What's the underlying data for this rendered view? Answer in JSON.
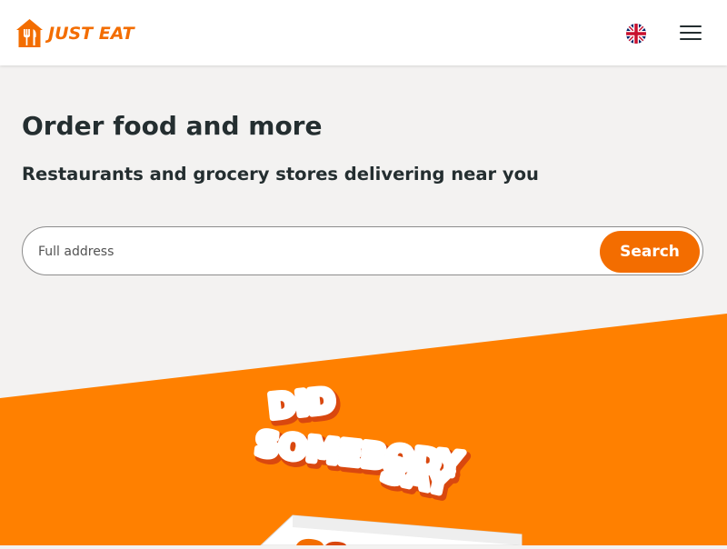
{
  "header": {
    "logo_text": "JUST EAT",
    "language_icon": "uk-flag-icon",
    "menu_icon": "hamburger-menu-icon"
  },
  "main": {
    "headline": "Order food and more",
    "subheadline": "Restaurants and grocery stores delivering near you",
    "search": {
      "placeholder": "Full address",
      "value": "",
      "button_label": "Search"
    }
  },
  "promo": {
    "lines": [
      "DID",
      "SOMEBODY",
      "SAY"
    ]
  },
  "colors": {
    "brand_orange": "#f36d00",
    "banner_orange": "#ff8000",
    "page_background": "#f3f2f1",
    "text_dark": "#242e30"
  }
}
